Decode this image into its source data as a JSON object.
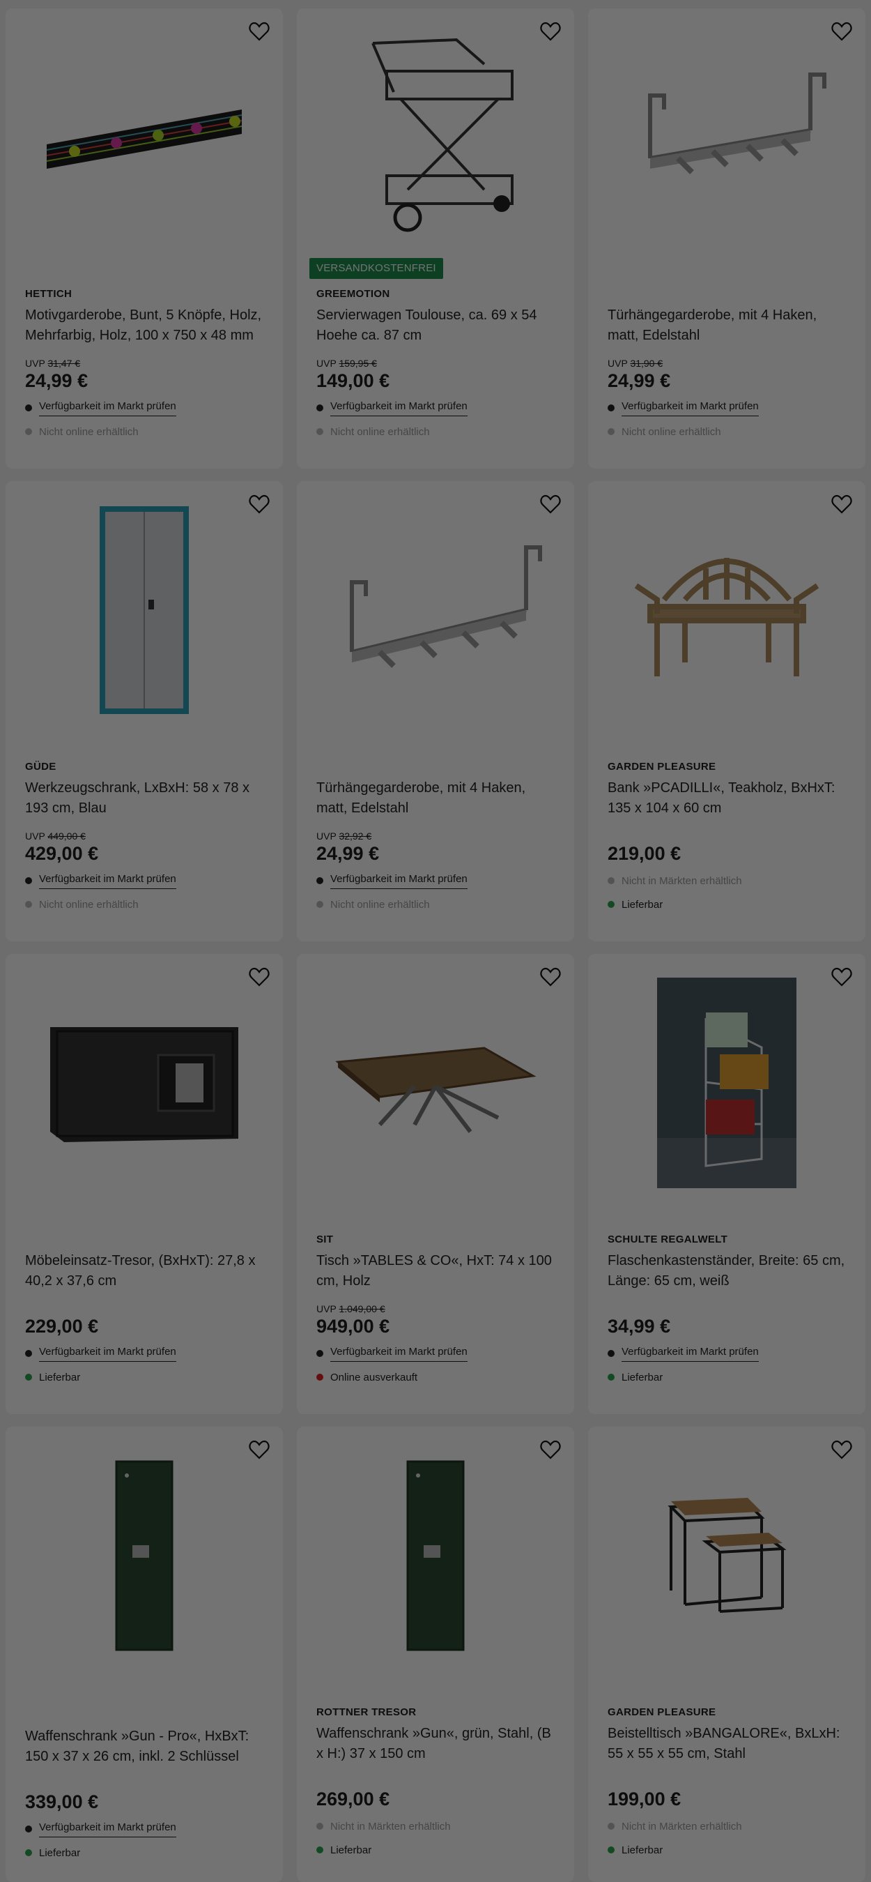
{
  "colors": {
    "badge": "#1e8f4e",
    "available": "#2ea44f",
    "soldout": "#e02020",
    "overlay": "rgba(0,0,0,0.55)"
  },
  "products": [
    {
      "brand": "HETTICH",
      "title": "Motivgarderobe, Bunt, 5 Knöpfe, Holz, Mehrfarbig, Holz, 100 x 750 x 48 mm",
      "uvp_label": "UVP",
      "uvp_old": "31,47 €",
      "price": "24,99 €",
      "line1": "Verfügbarkeit im Markt prüfen",
      "line2": "Nicht online erhältlich",
      "badge": ""
    },
    {
      "brand": "GREEMOTION",
      "title": "Servierwagen Toulouse, ca. 69 x 54 Hoehe ca. 87 cm",
      "uvp_label": "UVP",
      "uvp_old": "159,95 €",
      "price": "149,00 €",
      "line1": "Verfügbarkeit im Markt prüfen",
      "line2": "Nicht online erhältlich",
      "badge": "VERSANDKOSTENFREI"
    },
    {
      "brand": "",
      "title": "Türhängegarderobe, mit 4 Haken, matt, Edelstahl",
      "uvp_label": "UVP",
      "uvp_old": "31,90 €",
      "price": "24,99 €",
      "line1": "Verfügbarkeit im Markt prüfen",
      "line2": "Nicht online erhältlich",
      "badge": ""
    },
    {
      "brand": "GÜDE",
      "title": "Werkzeugschrank, LxBxH: 58 x 78 x 193 cm, Blau",
      "uvp_label": "UVP",
      "uvp_old": "449,00 €",
      "price": "429,00 €",
      "line1": "Verfügbarkeit im Markt prüfen",
      "line2": "Nicht online erhältlich",
      "badge": ""
    },
    {
      "brand": "",
      "title": "Türhängegarderobe, mit 4 Haken, matt, Edelstahl",
      "uvp_label": "UVP",
      "uvp_old": "32,92 €",
      "price": "24,99 €",
      "line1": "Verfügbarkeit im Markt prüfen",
      "line2": "Nicht online erhältlich",
      "badge": ""
    },
    {
      "brand": "GARDEN PLEASURE",
      "title": "Bank »PCADILLI«, Teakholz, BxHxT: 135 x 104 x 60 cm",
      "uvp_label": "",
      "uvp_old": "",
      "price": "219,00 €",
      "line1": "Nicht in Märkten erhältlich",
      "line2": "Lieferbar",
      "badge": ""
    },
    {
      "brand": "",
      "title": "Möbeleinsatz-Tresor, (BxHxT): 27,8 x 40,2 x 37,6 cm",
      "uvp_label": "",
      "uvp_old": "",
      "price": "229,00 €",
      "line1": "Verfügbarkeit im Markt prüfen",
      "line2": "Lieferbar",
      "badge": ""
    },
    {
      "brand": "SIT",
      "title": "Tisch »TABLES & CO«, HxT: 74 x 100 cm, Holz",
      "uvp_label": "UVP",
      "uvp_old": "1.049,00 €",
      "price": "949,00 €",
      "line1": "Verfügbarkeit im Markt prüfen",
      "line2": "Online ausverkauft",
      "badge": ""
    },
    {
      "brand": "SCHULTE REGALWELT",
      "title": "Flaschenkastenständer, Breite: 65 cm, Länge: 65 cm, weiß",
      "uvp_label": "",
      "uvp_old": "",
      "price": "34,99 €",
      "line1": "Verfügbarkeit im Markt prüfen",
      "line2": "Lieferbar",
      "badge": ""
    },
    {
      "brand": "",
      "title": "Waffenschrank »Gun - Pro«, HxBxT: 150 x 37 x 26 cm, inkl. 2 Schlüssel",
      "uvp_label": "",
      "uvp_old": "",
      "price": "339,00 €",
      "line1": "Verfügbarkeit im Markt prüfen",
      "line2": "Lieferbar",
      "badge": ""
    },
    {
      "brand": "ROTTNER TRESOR",
      "title": "Waffenschrank »Gun«, grün, Stahl, (B x H:) 37 x 150 cm",
      "uvp_label": "",
      "uvp_old": "",
      "price": "269,00 €",
      "line1": "Nicht in Märkten erhältlich",
      "line2": "Lieferbar",
      "badge": ""
    },
    {
      "brand": "GARDEN PLEASURE",
      "title": "Beistelltisch »BANGALORE«, BxLxH: 55 x 55 x 55 cm, Stahl",
      "uvp_label": "",
      "uvp_old": "",
      "price": "199,00 €",
      "line1": "Nicht in Märkten erhältlich",
      "line2": "Lieferbar",
      "badge": ""
    }
  ]
}
